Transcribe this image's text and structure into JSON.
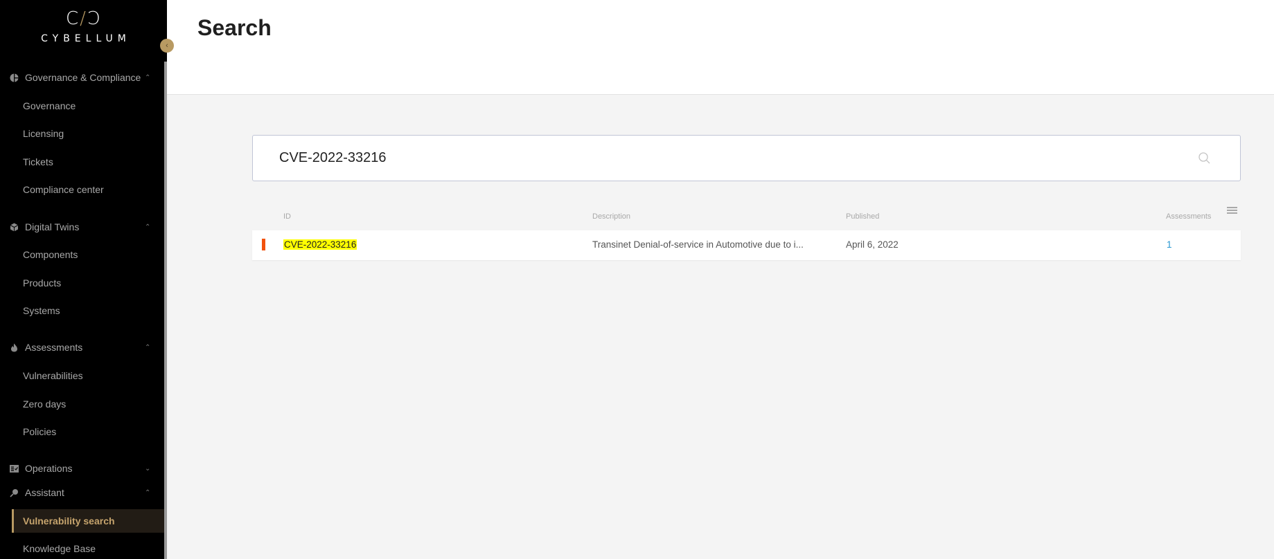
{
  "sidebar": {
    "logo_mark_left": "C",
    "logo_mark_slash": "/",
    "logo_mark_right": "Ɔ",
    "logo_text": "CYBELLUM",
    "toggle_icon": "‹",
    "groups": [
      {
        "label": "Governance & Compliance",
        "icon": "pie-chart-icon",
        "chevron": "⌃",
        "expanded": true,
        "items": [
          {
            "label": "Governance"
          },
          {
            "label": "Licensing"
          },
          {
            "label": "Tickets"
          },
          {
            "label": "Compliance center"
          }
        ]
      },
      {
        "label": "Digital Twins",
        "icon": "cube-icon",
        "chevron": "⌃",
        "expanded": true,
        "items": [
          {
            "label": "Components"
          },
          {
            "label": "Products"
          },
          {
            "label": "Systems"
          }
        ]
      },
      {
        "label": "Assessments",
        "icon": "flame-icon",
        "chevron": "⌃",
        "expanded": true,
        "items": [
          {
            "label": "Vulnerabilities"
          },
          {
            "label": "Zero days"
          },
          {
            "label": "Policies"
          }
        ]
      },
      {
        "label": "Operations",
        "icon": "checklist-icon",
        "chevron": "⌄",
        "expanded": false,
        "items": []
      },
      {
        "label": "Assistant",
        "icon": "magnifier-icon",
        "chevron": "⌃",
        "expanded": true,
        "items": [
          {
            "label": "Vulnerability search",
            "active": true
          },
          {
            "label": "Knowledge Base"
          }
        ]
      }
    ],
    "colors": {
      "background": "#000000",
      "accent": "#b89a62",
      "active_bg": "#221c15"
    }
  },
  "header": {
    "title": "Search"
  },
  "search": {
    "value": "CVE-2022-33216",
    "placeholder": ""
  },
  "table": {
    "columns": [
      "ID",
      "Description",
      "Published",
      "Assessments"
    ],
    "rows": [
      {
        "id": "CVE-2022-33216",
        "description": "Transinet Denial-of-service in Automotive due to i...",
        "published": "April 6, 2022",
        "assessments": "1",
        "severity_color": "#f2520d"
      }
    ]
  }
}
